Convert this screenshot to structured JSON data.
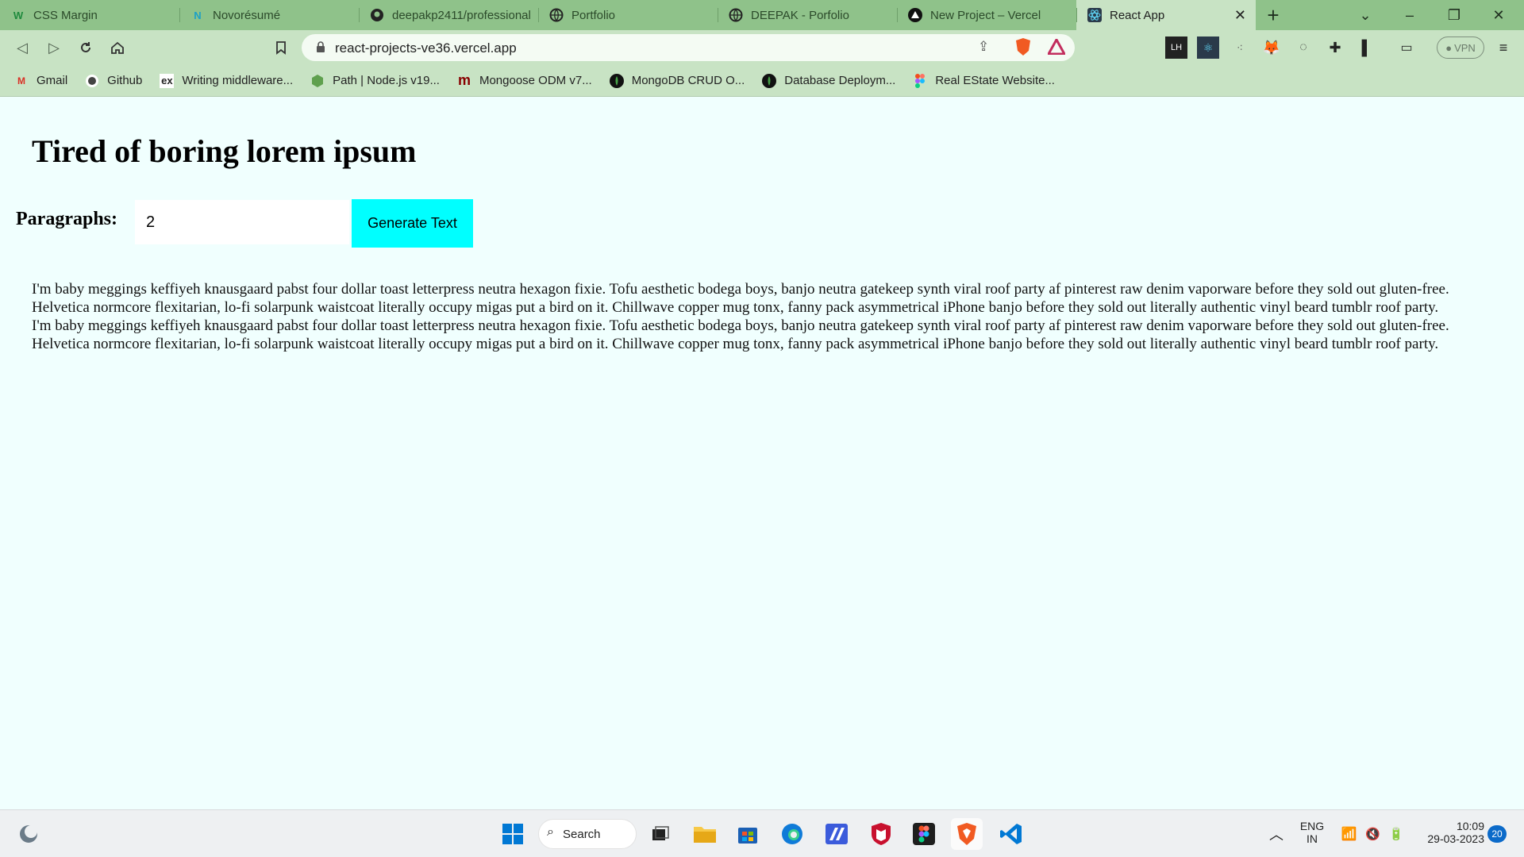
{
  "browser": {
    "tabs": [
      {
        "title": "CSS Margin",
        "icon": "w3schools-icon"
      },
      {
        "title": "Novorésumé",
        "icon": "novoresume-icon"
      },
      {
        "title": "deepakp2411/professional",
        "icon": "github-icon"
      },
      {
        "title": "Portfolio",
        "icon": "globe-icon"
      },
      {
        "title": "DEEPAK - Porfolio",
        "icon": "globe-icon"
      },
      {
        "title": "New Project – Vercel",
        "icon": "vercel-icon"
      },
      {
        "title": "React App",
        "icon": "react-icon",
        "active": true
      }
    ],
    "address": "react-projects-ve36.vercel.app",
    "vpn_label": "VPN",
    "bookmarks": [
      {
        "label": "Gmail",
        "icon": "gmail-icon"
      },
      {
        "label": "Github",
        "icon": "github-icon"
      },
      {
        "label": "Writing middleware...",
        "icon": "express-icon"
      },
      {
        "label": "Path | Node.js v19...",
        "icon": "nodejs-icon"
      },
      {
        "label": "Mongoose ODM v7...",
        "icon": "mongoose-icon"
      },
      {
        "label": "MongoDB CRUD O...",
        "icon": "mongodb-icon"
      },
      {
        "label": "Database Deploym...",
        "icon": "mongodb-icon"
      },
      {
        "label": "Real EState Website...",
        "icon": "figma-icon"
      }
    ]
  },
  "page": {
    "title": "Tired of boring lorem ipsum",
    "form": {
      "label": "Paragraphs:",
      "value": "2",
      "button": "Generate Text"
    },
    "paragraphs": [
      "I'm baby meggings keffiyeh knausgaard pabst four dollar toast letterpress neutra hexagon fixie. Tofu aesthetic bodega boys, banjo neutra gatekeep synth viral roof party af pinterest raw denim vaporware before they sold out gluten-free. Helvetica normcore flexitarian, lo-fi solarpunk waistcoat literally occupy migas put a bird on it. Chillwave copper mug tonx, fanny pack asymmetrical iPhone banjo before they sold out literally authentic vinyl beard tumblr roof party.",
      "I'm baby meggings keffiyeh knausgaard pabst four dollar toast letterpress neutra hexagon fixie. Tofu aesthetic bodega boys, banjo neutra gatekeep synth viral roof party af pinterest raw denim vaporware before they sold out gluten-free. Helvetica normcore flexitarian, lo-fi solarpunk waistcoat literally occupy migas put a bird on it. Chillwave copper mug tonx, fanny pack asymmetrical iPhone banjo before they sold out literally authentic vinyl beard tumblr roof party."
    ]
  },
  "taskbar": {
    "search_label": "Search",
    "lang_1": "ENG",
    "lang_2": "IN",
    "time": "10:09",
    "date": "29-03-2023",
    "notifications": "20"
  },
  "colors": {
    "tabbar": "#8fc28a",
    "toolbar": "#c8e3c4",
    "page_bg": "#f0fffe",
    "button": "#00ffff"
  }
}
